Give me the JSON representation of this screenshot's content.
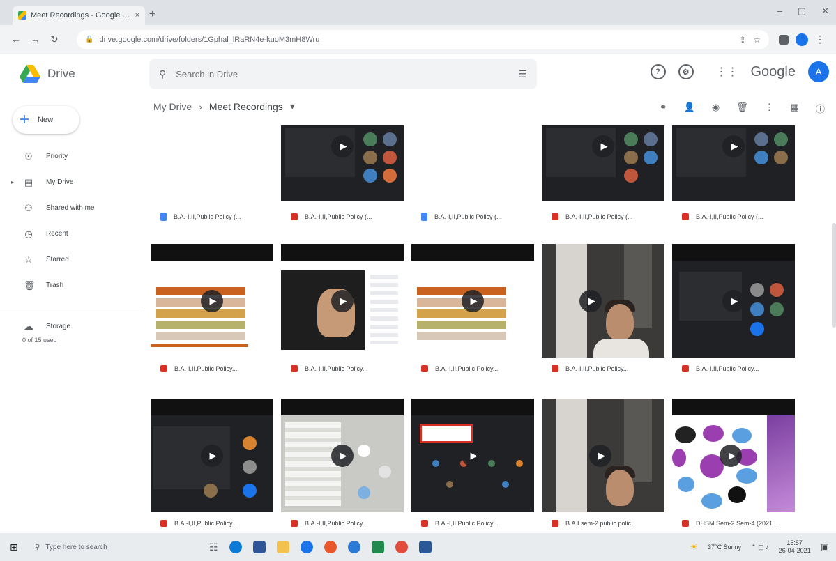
{
  "browser": {
    "tab_title": "Meet Recordings - Google Drive",
    "tab_close": "×",
    "new_tab": "+",
    "url": "drive.google.com/drive/folders/1Gphal_lRaRN4e-kuoM3mH8Wru"
  },
  "drive": {
    "app_name": "Drive",
    "search_placeholder": "Search in Drive",
    "brand": "Google",
    "avatar_letter": "A"
  },
  "sidebar": {
    "new_label": "New",
    "items": [
      {
        "label": "Priority",
        "icon": "priority-icon"
      },
      {
        "label": "My Drive",
        "icon": "my-drive-icon"
      },
      {
        "label": "Shared with me",
        "icon": "shared-icon"
      },
      {
        "label": "Recent",
        "icon": "clock-icon"
      },
      {
        "label": "Starred",
        "icon": "star-icon"
      },
      {
        "label": "Trash",
        "icon": "trash-icon"
      }
    ],
    "storage_label": "Storage",
    "storage_used": "0 of 15 used"
  },
  "breadcrumb": {
    "root": "My Drive",
    "separator": "›",
    "current": "Meet Recordings",
    "caret": "▾"
  },
  "files": [
    {
      "name": "B.A.-I,II,Public Policy (...",
      "type": "doc"
    },
    {
      "name": "B.A.-I,II,Public Policy (...",
      "type": "video"
    },
    {
      "name": "B.A.-I,II,Public Policy (...",
      "type": "doc"
    },
    {
      "name": "B.A.-I,II,Public Policy (...",
      "type": "video"
    },
    {
      "name": "B.A.-I,II,Public Policy (...",
      "type": "video"
    },
    {
      "name": "B.A.-I,II,Public Policy...",
      "type": "video"
    },
    {
      "name": "B.A.-I,II,Public Policy...",
      "type": "video"
    },
    {
      "name": "B.A.-I,II,Public Policy...",
      "type": "video"
    },
    {
      "name": "B.A.-I,II,Public Policy...",
      "type": "video"
    },
    {
      "name": "B.A.-I,II,Public Policy...",
      "type": "video"
    },
    {
      "name": "B.A.-I,II,Public Policy...",
      "type": "video"
    },
    {
      "name": "B.A.-I,II,Public Policy...",
      "type": "video"
    },
    {
      "name": "B.A.-I,II,Public Policy...",
      "type": "video"
    },
    {
      "name": "B.A.I sem-2 public polic...",
      "type": "video"
    },
    {
      "name": "DHSM Sem-2 Sem-4 (2021...",
      "type": "video"
    }
  ],
  "taskbar": {
    "search_placeholder": "Type here to search",
    "weather": "37°C Sunny",
    "time": "15:57",
    "date": "26-04-2021"
  }
}
